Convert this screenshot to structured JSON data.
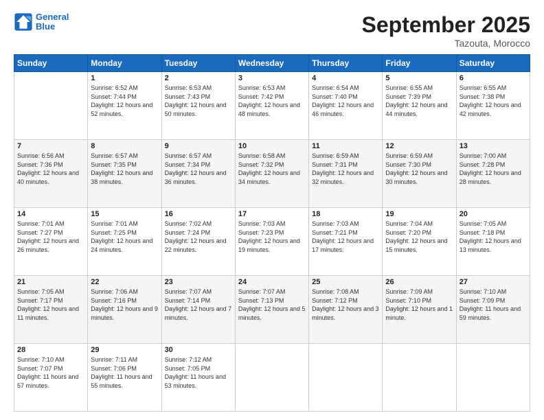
{
  "header": {
    "logo_line1": "General",
    "logo_line2": "Blue",
    "month_title": "September 2025",
    "subtitle": "Tazouta, Morocco"
  },
  "weekdays": [
    "Sunday",
    "Monday",
    "Tuesday",
    "Wednesday",
    "Thursday",
    "Friday",
    "Saturday"
  ],
  "weeks": [
    [
      {
        "day": "",
        "sunrise": "",
        "sunset": "",
        "daylight": ""
      },
      {
        "day": "1",
        "sunrise": "Sunrise: 6:52 AM",
        "sunset": "Sunset: 7:44 PM",
        "daylight": "Daylight: 12 hours and 52 minutes."
      },
      {
        "day": "2",
        "sunrise": "Sunrise: 6:53 AM",
        "sunset": "Sunset: 7:43 PM",
        "daylight": "Daylight: 12 hours and 50 minutes."
      },
      {
        "day": "3",
        "sunrise": "Sunrise: 6:53 AM",
        "sunset": "Sunset: 7:42 PM",
        "daylight": "Daylight: 12 hours and 48 minutes."
      },
      {
        "day": "4",
        "sunrise": "Sunrise: 6:54 AM",
        "sunset": "Sunset: 7:40 PM",
        "daylight": "Daylight: 12 hours and 46 minutes."
      },
      {
        "day": "5",
        "sunrise": "Sunrise: 6:55 AM",
        "sunset": "Sunset: 7:39 PM",
        "daylight": "Daylight: 12 hours and 44 minutes."
      },
      {
        "day": "6",
        "sunrise": "Sunrise: 6:55 AM",
        "sunset": "Sunset: 7:38 PM",
        "daylight": "Daylight: 12 hours and 42 minutes."
      }
    ],
    [
      {
        "day": "7",
        "sunrise": "Sunrise: 6:56 AM",
        "sunset": "Sunset: 7:36 PM",
        "daylight": "Daylight: 12 hours and 40 minutes."
      },
      {
        "day": "8",
        "sunrise": "Sunrise: 6:57 AM",
        "sunset": "Sunset: 7:35 PM",
        "daylight": "Daylight: 12 hours and 38 minutes."
      },
      {
        "day": "9",
        "sunrise": "Sunrise: 6:57 AM",
        "sunset": "Sunset: 7:34 PM",
        "daylight": "Daylight: 12 hours and 36 minutes."
      },
      {
        "day": "10",
        "sunrise": "Sunrise: 6:58 AM",
        "sunset": "Sunset: 7:32 PM",
        "daylight": "Daylight: 12 hours and 34 minutes."
      },
      {
        "day": "11",
        "sunrise": "Sunrise: 6:59 AM",
        "sunset": "Sunset: 7:31 PM",
        "daylight": "Daylight: 12 hours and 32 minutes."
      },
      {
        "day": "12",
        "sunrise": "Sunrise: 6:59 AM",
        "sunset": "Sunset: 7:30 PM",
        "daylight": "Daylight: 12 hours and 30 minutes."
      },
      {
        "day": "13",
        "sunrise": "Sunrise: 7:00 AM",
        "sunset": "Sunset: 7:28 PM",
        "daylight": "Daylight: 12 hours and 28 minutes."
      }
    ],
    [
      {
        "day": "14",
        "sunrise": "Sunrise: 7:01 AM",
        "sunset": "Sunset: 7:27 PM",
        "daylight": "Daylight: 12 hours and 26 minutes."
      },
      {
        "day": "15",
        "sunrise": "Sunrise: 7:01 AM",
        "sunset": "Sunset: 7:25 PM",
        "daylight": "Daylight: 12 hours and 24 minutes."
      },
      {
        "day": "16",
        "sunrise": "Sunrise: 7:02 AM",
        "sunset": "Sunset: 7:24 PM",
        "daylight": "Daylight: 12 hours and 22 minutes."
      },
      {
        "day": "17",
        "sunrise": "Sunrise: 7:03 AM",
        "sunset": "Sunset: 7:23 PM",
        "daylight": "Daylight: 12 hours and 19 minutes."
      },
      {
        "day": "18",
        "sunrise": "Sunrise: 7:03 AM",
        "sunset": "Sunset: 7:21 PM",
        "daylight": "Daylight: 12 hours and 17 minutes."
      },
      {
        "day": "19",
        "sunrise": "Sunrise: 7:04 AM",
        "sunset": "Sunset: 7:20 PM",
        "daylight": "Daylight: 12 hours and 15 minutes."
      },
      {
        "day": "20",
        "sunrise": "Sunrise: 7:05 AM",
        "sunset": "Sunset: 7:18 PM",
        "daylight": "Daylight: 12 hours and 13 minutes."
      }
    ],
    [
      {
        "day": "21",
        "sunrise": "Sunrise: 7:05 AM",
        "sunset": "Sunset: 7:17 PM",
        "daylight": "Daylight: 12 hours and 11 minutes."
      },
      {
        "day": "22",
        "sunrise": "Sunrise: 7:06 AM",
        "sunset": "Sunset: 7:16 PM",
        "daylight": "Daylight: 12 hours and 9 minutes."
      },
      {
        "day": "23",
        "sunrise": "Sunrise: 7:07 AM",
        "sunset": "Sunset: 7:14 PM",
        "daylight": "Daylight: 12 hours and 7 minutes."
      },
      {
        "day": "24",
        "sunrise": "Sunrise: 7:07 AM",
        "sunset": "Sunset: 7:13 PM",
        "daylight": "Daylight: 12 hours and 5 minutes."
      },
      {
        "day": "25",
        "sunrise": "Sunrise: 7:08 AM",
        "sunset": "Sunset: 7:12 PM",
        "daylight": "Daylight: 12 hours and 3 minutes."
      },
      {
        "day": "26",
        "sunrise": "Sunrise: 7:09 AM",
        "sunset": "Sunset: 7:10 PM",
        "daylight": "Daylight: 12 hours and 1 minute."
      },
      {
        "day": "27",
        "sunrise": "Sunrise: 7:10 AM",
        "sunset": "Sunset: 7:09 PM",
        "daylight": "Daylight: 11 hours and 59 minutes."
      }
    ],
    [
      {
        "day": "28",
        "sunrise": "Sunrise: 7:10 AM",
        "sunset": "Sunset: 7:07 PM",
        "daylight": "Daylight: 11 hours and 57 minutes."
      },
      {
        "day": "29",
        "sunrise": "Sunrise: 7:11 AM",
        "sunset": "Sunset: 7:06 PM",
        "daylight": "Daylight: 11 hours and 55 minutes."
      },
      {
        "day": "30",
        "sunrise": "Sunrise: 7:12 AM",
        "sunset": "Sunset: 7:05 PM",
        "daylight": "Daylight: 11 hours and 53 minutes."
      },
      {
        "day": "",
        "sunrise": "",
        "sunset": "",
        "daylight": ""
      },
      {
        "day": "",
        "sunrise": "",
        "sunset": "",
        "daylight": ""
      },
      {
        "day": "",
        "sunrise": "",
        "sunset": "",
        "daylight": ""
      },
      {
        "day": "",
        "sunrise": "",
        "sunset": "",
        "daylight": ""
      }
    ]
  ]
}
